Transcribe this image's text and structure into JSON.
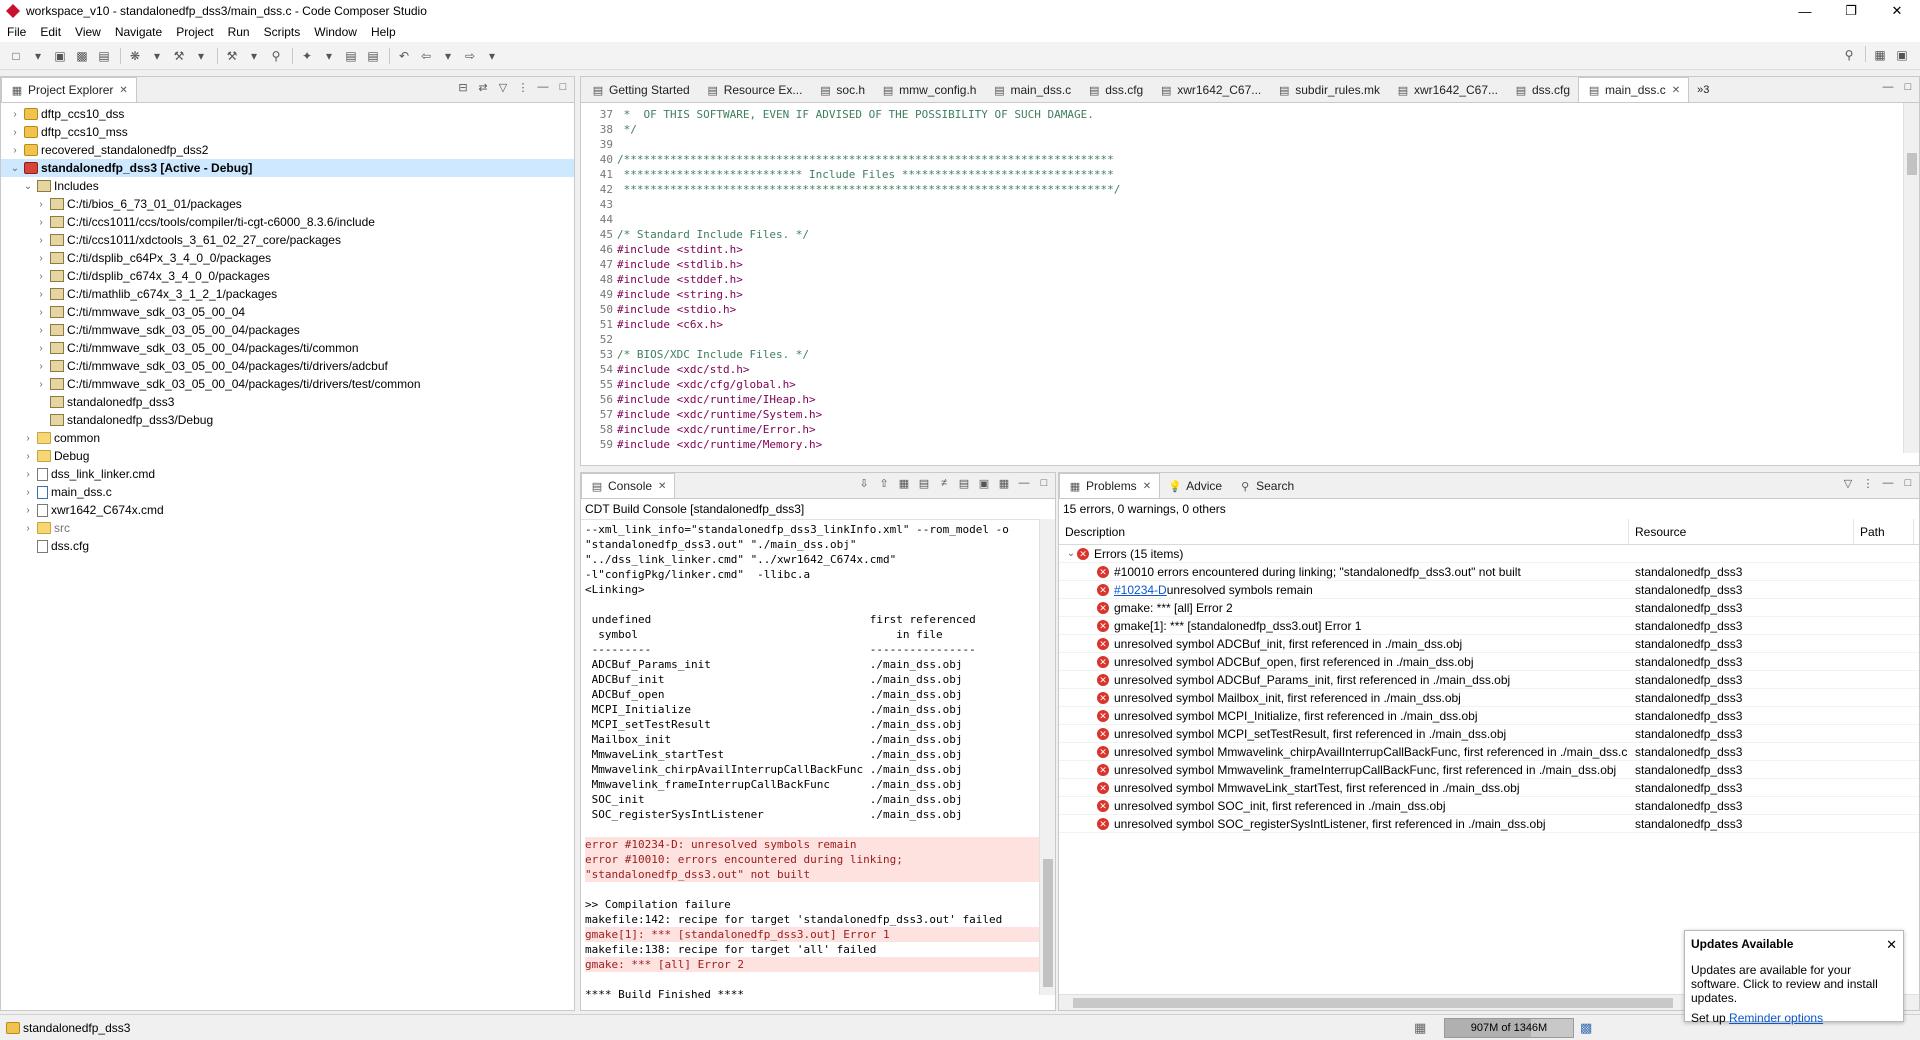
{
  "window": {
    "title": "workspace_v10 - standalonedfp_dss3/main_dss.c - Code Composer Studio"
  },
  "menu": [
    "File",
    "Edit",
    "View",
    "Navigate",
    "Project",
    "Run",
    "Scripts",
    "Window",
    "Help"
  ],
  "explorer": {
    "tab_label": "Project Explorer",
    "tree": [
      {
        "label": "dftp_ccs10_dss",
        "depth": 0,
        "icon": "project-icon",
        "expander": "›"
      },
      {
        "label": "dftp_ccs10_mss",
        "depth": 0,
        "icon": "project-icon",
        "expander": "›"
      },
      {
        "label": "recovered_standalonedfp_dss2",
        "depth": 0,
        "icon": "project-icon",
        "expander": "›"
      },
      {
        "label": "standalonedfp_dss3  [Active - Debug]",
        "depth": 0,
        "icon": "active-project-icon",
        "expander": "⌄",
        "selected": true
      },
      {
        "label": "Includes",
        "depth": 1,
        "icon": "includes-icon",
        "expander": "⌄"
      },
      {
        "label": "C:/ti/bios_6_73_01_01/packages",
        "depth": 2,
        "icon": "library-icon",
        "expander": "›"
      },
      {
        "label": "C:/ti/ccs1011/ccs/tools/compiler/ti-cgt-c6000_8.3.6/include",
        "depth": 2,
        "icon": "library-icon",
        "expander": "›"
      },
      {
        "label": "C:/ti/ccs1011/xdctools_3_61_02_27_core/packages",
        "depth": 2,
        "icon": "library-icon",
        "expander": "›"
      },
      {
        "label": "C:/ti/dsplib_c64Px_3_4_0_0/packages",
        "depth": 2,
        "icon": "library-icon",
        "expander": "›"
      },
      {
        "label": "C:/ti/dsplib_c674x_3_4_0_0/packages",
        "depth": 2,
        "icon": "library-icon",
        "expander": "›"
      },
      {
        "label": "C:/ti/mathlib_c674x_3_1_2_1/packages",
        "depth": 2,
        "icon": "library-icon",
        "expander": "›"
      },
      {
        "label": "C:/ti/mmwave_sdk_03_05_00_04",
        "depth": 2,
        "icon": "library-icon",
        "expander": "›"
      },
      {
        "label": "C:/ti/mmwave_sdk_03_05_00_04/packages",
        "depth": 2,
        "icon": "library-icon",
        "expander": "›"
      },
      {
        "label": "C:/ti/mmwave_sdk_03_05_00_04/packages/ti/common",
        "depth": 2,
        "icon": "library-icon",
        "expander": "›"
      },
      {
        "label": "C:/ti/mmwave_sdk_03_05_00_04/packages/ti/drivers/adcbuf",
        "depth": 2,
        "icon": "library-icon",
        "expander": "›"
      },
      {
        "label": "C:/ti/mmwave_sdk_03_05_00_04/packages/ti/drivers/test/common",
        "depth": 2,
        "icon": "library-icon",
        "expander": "›"
      },
      {
        "label": "standalonedfp_dss3",
        "depth": 2,
        "icon": "library-icon",
        "expander": ""
      },
      {
        "label": "standalonedfp_dss3/Debug",
        "depth": 2,
        "icon": "library-icon",
        "expander": ""
      },
      {
        "label": "common",
        "depth": 1,
        "icon": "folder-icon",
        "expander": "›"
      },
      {
        "label": "Debug",
        "depth": 1,
        "icon": "folder-icon",
        "expander": "›"
      },
      {
        "label": "dss_link_linker.cmd",
        "depth": 1,
        "icon": "file-icon",
        "expander": "›"
      },
      {
        "label": "main_dss.c",
        "depth": 1,
        "icon": "c-file-icon",
        "expander": "›"
      },
      {
        "label": "xwr1642_C674x.cmd",
        "depth": 1,
        "icon": "file-icon",
        "expander": "›"
      },
      {
        "label": "src",
        "depth": 1,
        "icon": "folder-icon",
        "expander": "›"
      },
      {
        "label": "dss.cfg",
        "depth": 1,
        "icon": "file-icon",
        "expander": ""
      }
    ]
  },
  "editor": {
    "tabs": [
      {
        "label": "Getting Started",
        "icon": "getting-started-icon"
      },
      {
        "label": "Resource Ex...",
        "icon": "resource-explorer-icon"
      },
      {
        "label": "soc.h",
        "icon": "header-file-icon"
      },
      {
        "label": "mmw_config.h",
        "icon": "header-file-icon"
      },
      {
        "label": "main_dss.c",
        "icon": "c-file-icon"
      },
      {
        "label": "dss.cfg",
        "icon": "config-file-icon"
      },
      {
        "label": "xwr1642_C67...",
        "icon": "linker-file-icon"
      },
      {
        "label": "subdir_rules.mk",
        "icon": "makefile-icon"
      },
      {
        "label": "xwr1642_C67...",
        "icon": "linker-file-icon"
      },
      {
        "label": "dss.cfg",
        "icon": "config-file-icon"
      },
      {
        "label": "main_dss.c",
        "icon": "c-file-icon",
        "active": true
      }
    ],
    "overflow_label": "»3",
    "lines": [
      {
        "n": "37",
        "text": " *  OF THIS SOFTWARE, EVEN IF ADVISED OF THE POSSIBILITY OF SUCH DAMAGE.",
        "kind": "comment"
      },
      {
        "n": "38",
        "text": " */",
        "kind": "comment"
      },
      {
        "n": "39",
        "text": "",
        "kind": "plain"
      },
      {
        "n": "40",
        "text": "/**************************************************************************",
        "kind": "comment"
      },
      {
        "n": "41",
        "text": " *************************** Include Files ********************************",
        "kind": "comment"
      },
      {
        "n": "42",
        "text": " **************************************************************************/",
        "kind": "comment"
      },
      {
        "n": "43",
        "text": "",
        "kind": "plain"
      },
      {
        "n": "44",
        "text": "",
        "kind": "plain"
      },
      {
        "n": "45",
        "text": "/* Standard Include Files. */",
        "kind": "comment"
      },
      {
        "n": "46",
        "text": "#include <stdint.h>",
        "kind": "include"
      },
      {
        "n": "47",
        "text": "#include <stdlib.h>",
        "kind": "include"
      },
      {
        "n": "48",
        "text": "#include <stddef.h>",
        "kind": "include"
      },
      {
        "n": "49",
        "text": "#include <string.h>",
        "kind": "include"
      },
      {
        "n": "50",
        "text": "#include <stdio.h>",
        "kind": "include"
      },
      {
        "n": "51",
        "text": "#include <c6x.h>",
        "kind": "include"
      },
      {
        "n": "52",
        "text": "",
        "kind": "plain"
      },
      {
        "n": "53",
        "text": "/* BIOS/XDC Include Files. */",
        "kind": "comment"
      },
      {
        "n": "54",
        "text": "#include <xdc/std.h>",
        "kind": "include"
      },
      {
        "n": "55",
        "text": "#include <xdc/cfg/global.h>",
        "kind": "include"
      },
      {
        "n": "56",
        "text": "#include <xdc/runtime/IHeap.h>",
        "kind": "include"
      },
      {
        "n": "57",
        "text": "#include <xdc/runtime/System.h>",
        "kind": "include"
      },
      {
        "n": "58",
        "text": "#include <xdc/runtime/Error.h>",
        "kind": "include"
      },
      {
        "n": "59",
        "text": "#include <xdc/runtime/Memory.h>",
        "kind": "include"
      }
    ]
  },
  "console": {
    "tab_label": "Console",
    "header": "CDT Build Console [standalonedfp_dss3]",
    "lines": [
      {
        "text": "--xml_link_info=\"standalonedfp_dss3_linkInfo.xml\" --rom_model -o",
        "err": false
      },
      {
        "text": "\"standalonedfp_dss3.out\" \"./main_dss.obj\"",
        "err": false
      },
      {
        "text": "\"../dss_link_linker.cmd\" \"../xwr1642_C674x.cmd\"",
        "err": false
      },
      {
        "text": "-l\"configPkg/linker.cmd\"  -llibc.a",
        "err": false
      },
      {
        "text": "<Linking>",
        "err": false
      },
      {
        "text": "",
        "err": false
      },
      {
        "text": " undefined                                 first referenced",
        "err": false
      },
      {
        "text": "  symbol                                       in file",
        "err": false
      },
      {
        "text": " ---------                                 ----------------",
        "err": false
      },
      {
        "text": " ADCBuf_Params_init                        ./main_dss.obj",
        "err": false
      },
      {
        "text": " ADCBuf_init                               ./main_dss.obj",
        "err": false
      },
      {
        "text": " ADCBuf_open                               ./main_dss.obj",
        "err": false
      },
      {
        "text": " MCPI_Initialize                           ./main_dss.obj",
        "err": false
      },
      {
        "text": " MCPI_setTestResult                        ./main_dss.obj",
        "err": false
      },
      {
        "text": " Mailbox_init                              ./main_dss.obj",
        "err": false
      },
      {
        "text": " MmwaveLink_startTest                      ./main_dss.obj",
        "err": false
      },
      {
        "text": " Mmwavelink_chirpAvailInterrupCallBackFunc ./main_dss.obj",
        "err": false
      },
      {
        "text": " Mmwavelink_frameInterrupCallBackFunc      ./main_dss.obj",
        "err": false
      },
      {
        "text": " SOC_init                                  ./main_dss.obj",
        "err": false
      },
      {
        "text": " SOC_registerSysIntListener                ./main_dss.obj",
        "err": false
      },
      {
        "text": "",
        "err": false
      },
      {
        "text": "error #10234-D: unresolved symbols remain",
        "err": true
      },
      {
        "text": "error #10010: errors encountered during linking;",
        "err": true
      },
      {
        "text": "\"standalonedfp_dss3.out\" not built",
        "err": true
      },
      {
        "text": "",
        "err": false
      },
      {
        "text": ">> Compilation failure",
        "err": false
      },
      {
        "text": "makefile:142: recipe for target 'standalonedfp_dss3.out' failed",
        "err": false
      },
      {
        "text": "gmake[1]: *** [standalonedfp_dss3.out] Error 1",
        "err": true
      },
      {
        "text": "makefile:138: recipe for target 'all' failed",
        "err": false
      },
      {
        "text": "gmake: *** [all] Error 2",
        "err": true
      },
      {
        "text": "",
        "err": false
      },
      {
        "text": "**** Build Finished ****",
        "err": false
      }
    ]
  },
  "problems": {
    "tabs": [
      {
        "label": "Problems",
        "icon": "problems-icon",
        "active": true
      },
      {
        "label": "Advice",
        "icon": "advice-icon"
      },
      {
        "label": "Search",
        "icon": "search-icon"
      }
    ],
    "summary": "15 errors, 0 warnings, 0 others",
    "columns": [
      "Description",
      "Resource",
      "Path"
    ],
    "group_label": "Errors (15 items)",
    "rows": [
      {
        "desc": "#10010 errors encountered during linking; \"standalonedfp_dss3.out\" not built",
        "resource": "standalonedfp_dss3"
      },
      {
        "desc_link": "#10234-D",
        "desc": " unresolved symbols remain",
        "resource": "standalonedfp_dss3"
      },
      {
        "desc": "gmake: *** [all] Error 2",
        "resource": "standalonedfp_dss3"
      },
      {
        "desc": "gmake[1]: *** [standalonedfp_dss3.out] Error 1",
        "resource": "standalonedfp_dss3"
      },
      {
        "desc": "unresolved symbol ADCBuf_init, first referenced in ./main_dss.obj",
        "resource": "standalonedfp_dss3"
      },
      {
        "desc": "unresolved symbol ADCBuf_open, first referenced in ./main_dss.obj",
        "resource": "standalonedfp_dss3"
      },
      {
        "desc": "unresolved symbol ADCBuf_Params_init, first referenced in ./main_dss.obj",
        "resource": "standalonedfp_dss3"
      },
      {
        "desc": "unresolved symbol Mailbox_init, first referenced in ./main_dss.obj",
        "resource": "standalonedfp_dss3"
      },
      {
        "desc": "unresolved symbol MCPI_Initialize, first referenced in ./main_dss.obj",
        "resource": "standalonedfp_dss3"
      },
      {
        "desc": "unresolved symbol MCPI_setTestResult, first referenced in ./main_dss.obj",
        "resource": "standalonedfp_dss3"
      },
      {
        "desc": "unresolved symbol Mmwavelink_chirpAvailInterrupCallBackFunc, first referenced in ./main_dss.c",
        "resource": "standalonedfp_dss3"
      },
      {
        "desc": "unresolved symbol Mmwavelink_frameInterrupCallBackFunc, first referenced in ./main_dss.obj",
        "resource": "standalonedfp_dss3"
      },
      {
        "desc": "unresolved symbol MmwaveLink_startTest, first referenced in ./main_dss.obj",
        "resource": "standalonedfp_dss3"
      },
      {
        "desc": "unresolved symbol SOC_init, first referenced in ./main_dss.obj",
        "resource": "standalonedfp_dss3"
      },
      {
        "desc": "unresolved symbol SOC_registerSysIntListener, first referenced in ./main_dss.obj",
        "resource": "standalonedfp_dss3"
      }
    ]
  },
  "statusbar": {
    "project": "standalonedfp_dss3",
    "heap": "907M of 1346M",
    "heap_used_fraction": 0.674
  },
  "notification": {
    "title": "Updates Available",
    "body": "Updates are available for your software. Click to review and install updates.",
    "setup_prefix": "Set up ",
    "link": "Reminder options"
  },
  "colors": {
    "error_bg": "#fde2e0",
    "error_icon": "#d9342b",
    "link": "#0b57d0",
    "selection": "#cde8ff"
  }
}
